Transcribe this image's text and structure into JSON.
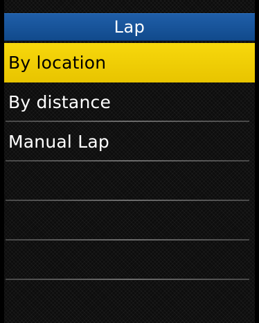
{
  "title_bar": {
    "title": "Lap"
  },
  "menu": {
    "items": [
      {
        "label": "By location",
        "selected": true
      },
      {
        "label": "By distance",
        "selected": false
      },
      {
        "label": "Manual Lap",
        "selected": false
      },
      {
        "label": "",
        "selected": false
      },
      {
        "label": "",
        "selected": false
      },
      {
        "label": "",
        "selected": false
      },
      {
        "label": "",
        "selected": false
      }
    ]
  },
  "colors": {
    "title_bar": "#1a56a0",
    "selection": "#f5d400",
    "background": "#0d0d0d",
    "text": "#ffffff",
    "selected_text": "#000000"
  }
}
